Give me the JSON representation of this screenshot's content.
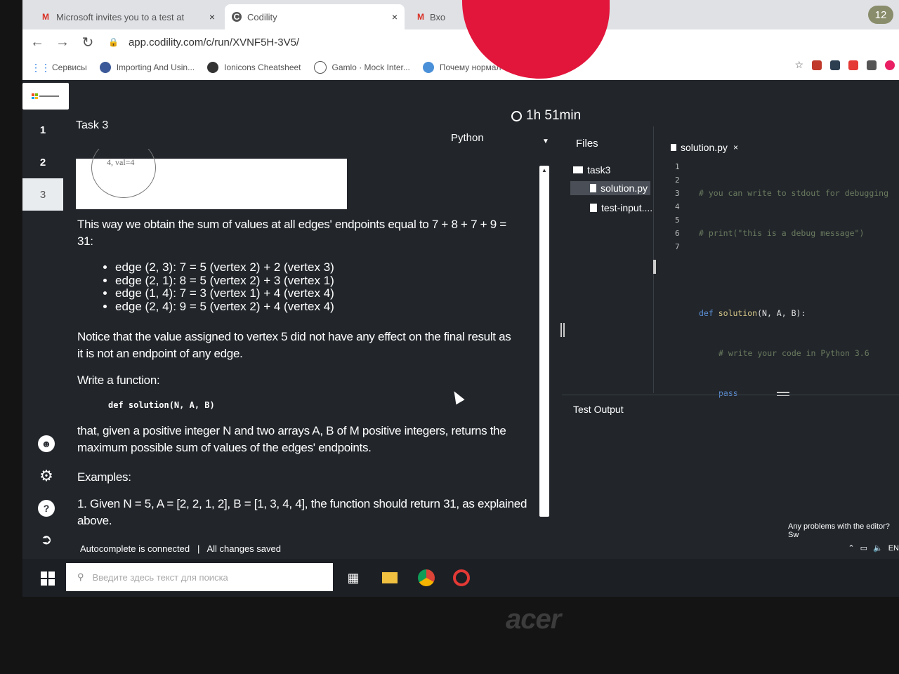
{
  "browser": {
    "tabs": [
      {
        "label": "Microsoft invites you to a test at",
        "favicon": "M",
        "close": "×"
      },
      {
        "label": "Codility",
        "favicon": "C",
        "close": "×"
      },
      {
        "label": "Вхо",
        "favicon": "M"
      }
    ],
    "tab_count": "12",
    "url": "app.codility.com/c/run/XVNF5H-3V5/",
    "bookmarks": [
      {
        "label": "Сервисы"
      },
      {
        "label": "Importing And Usin..."
      },
      {
        "label": "Ionicons Cheatsheet"
      },
      {
        "label": "Gamlo · Mock Inter..."
      },
      {
        "label": "Почему нормал ит..."
      }
    ]
  },
  "app": {
    "timer": "1h 51min",
    "task_numbers": [
      "1",
      "2",
      "3"
    ],
    "task_title": "Task 3",
    "language": "Python",
    "graph_label": "4, val=4",
    "description": {
      "sum_text_1": "This way we obtain the sum of values at all edges' endpoints equal to 7 + 8 + 7 + 9 =",
      "sum_text_2": "31:",
      "edges": [
        "edge (2, 3): 7 = 5 (vertex 2) + 2 (vertex 3)",
        "edge (2, 1): 8 = 5 (vertex 2) + 3 (vertex 1)",
        "edge (1, 4): 7 = 3 (vertex 1) + 4 (vertex 4)",
        "edge (2, 4): 9 = 5 (vertex 2) + 4 (vertex 4)"
      ],
      "notice_1": "Notice that the value assigned to vertex 5 did not have any effect on the final result as",
      "notice_2": "it is not an endpoint of any edge.",
      "write_function": "Write a function:",
      "signature": "def solution(N, A, B)",
      "given_1": "that, given a positive integer N and two arrays A, B of M positive integers, returns the",
      "given_2": "maximum possible sum of values of the edges' endpoints.",
      "examples_heading": "Examples:",
      "example_1a": "1. Given N = 5, A = [2, 2, 1, 2], B = [1, 3, 4, 4], the function should return 31, as explained",
      "example_1b": "above."
    },
    "files": {
      "header": "Files",
      "folder": "task3",
      "items": [
        "solution.py",
        "test-input...."
      ]
    },
    "editor": {
      "tab": "solution.py",
      "tab_close": "×",
      "line_numbers": [
        "1",
        "2",
        "3",
        "4",
        "5",
        "6",
        "7"
      ],
      "code": {
        "l1": "# you can write to stdout for debugging",
        "l2": "# print(\"this is a debug message\")",
        "l4_kw": "def",
        "l4_fn": "solution",
        "l4_params": "(N, A, B):",
        "l5": "# write your code in Python 3.6",
        "l6": "pass"
      }
    },
    "test_output": "Test Output",
    "status": {
      "autocomplete": "Autocomplete is connected",
      "separator": "|",
      "saved": "All changes saved"
    },
    "problems_link": "Any problems with the editor? Sw"
  },
  "taskbar": {
    "search_placeholder": "Введите здесь текст для поиска",
    "tray_lang": "EN"
  },
  "laptop_brand": "acer",
  "colors": {
    "app_bg": "#22262b",
    "accent_blue": "#5c8fd6",
    "blob_red": "#e2153b"
  }
}
